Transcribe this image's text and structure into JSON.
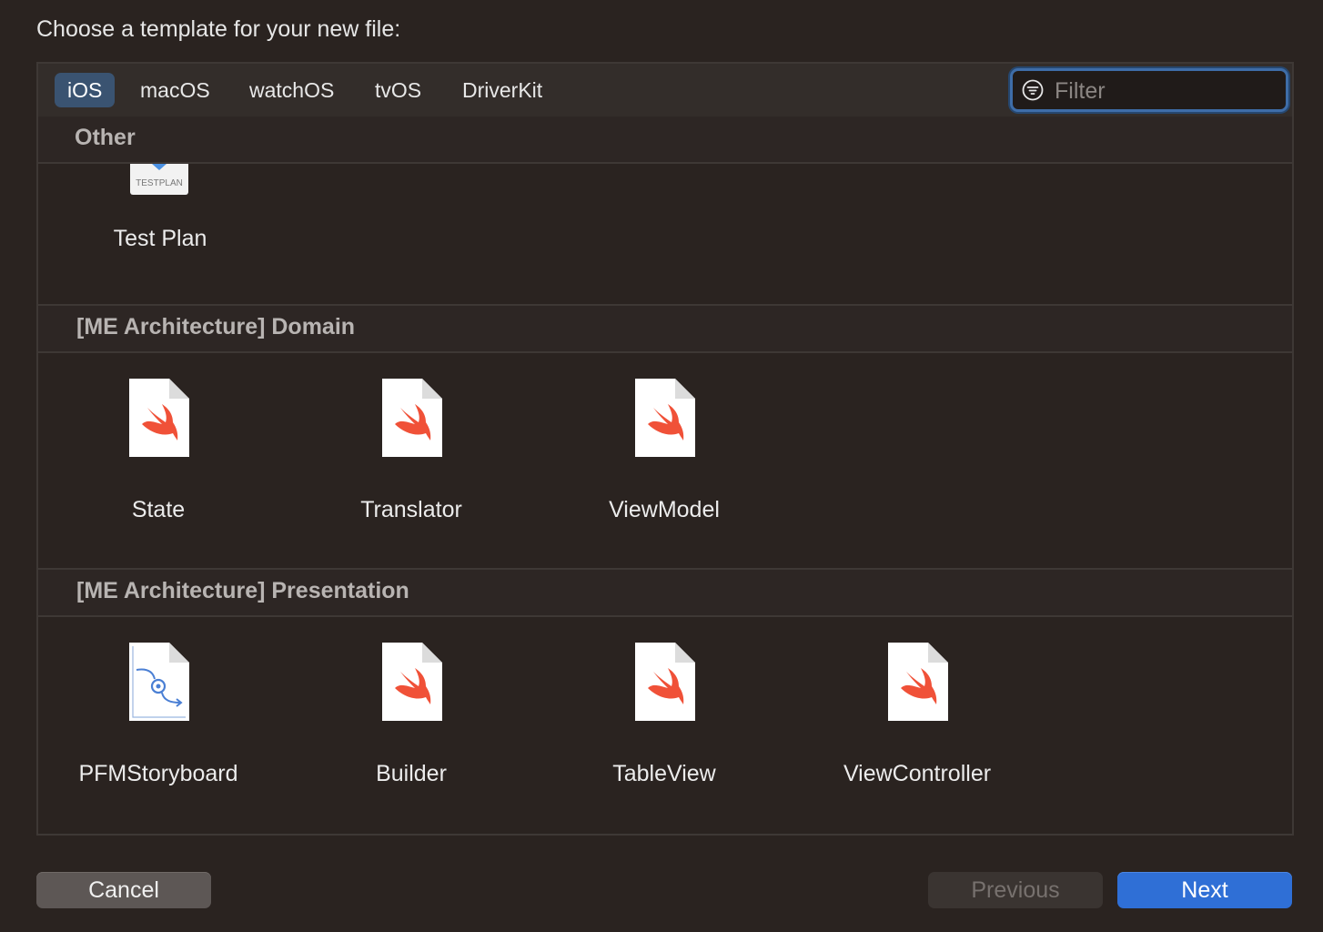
{
  "dialog": {
    "prompt": "Choose a template for your new file:"
  },
  "platform_tabs": [
    {
      "label": "iOS",
      "selected": true
    },
    {
      "label": "macOS",
      "selected": false
    },
    {
      "label": "watchOS",
      "selected": false
    },
    {
      "label": "tvOS",
      "selected": false
    },
    {
      "label": "DriverKit",
      "selected": false
    }
  ],
  "filter": {
    "placeholder": "Filter",
    "value": "",
    "icon": "filter-icon"
  },
  "sections": [
    {
      "title": "Other",
      "templates": [
        {
          "label": "Test Plan",
          "icon": "testplan-icon",
          "icon_text": "TESTPLAN"
        }
      ]
    },
    {
      "title": "[ME Architecture] Domain",
      "templates": [
        {
          "label": "State",
          "icon": "swift-file-icon"
        },
        {
          "label": "Translator",
          "icon": "swift-file-icon"
        },
        {
          "label": "ViewModel",
          "icon": "swift-file-icon"
        }
      ]
    },
    {
      "title": "[ME Architecture] Presentation",
      "templates": [
        {
          "label": "PFMStoryboard",
          "icon": "storyboard-file-icon"
        },
        {
          "label": "Builder",
          "icon": "swift-file-icon"
        },
        {
          "label": "TableView",
          "icon": "swift-file-icon"
        },
        {
          "label": "ViewController",
          "icon": "swift-file-icon"
        }
      ]
    }
  ],
  "buttons": {
    "cancel": "Cancel",
    "previous": "Previous",
    "next": "Next"
  },
  "colors": {
    "background": "#2a2320",
    "selected_tab": "#3a5371",
    "accent": "#2f6fd6",
    "swift_orange": "#f05138"
  }
}
